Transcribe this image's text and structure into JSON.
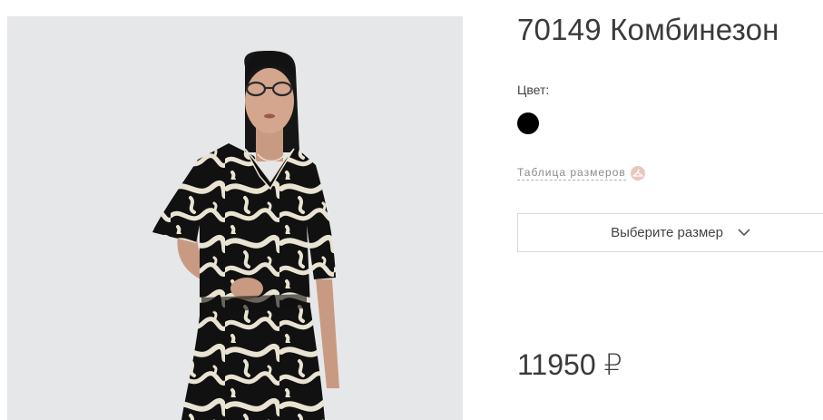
{
  "product": {
    "title": "70149 Комбинезон",
    "price": "11950 ₽"
  },
  "color": {
    "label": "Цвет:",
    "selected_swatch": "#000000"
  },
  "size_table": {
    "label": "Таблица размеров",
    "icon": "hanger-icon"
  },
  "size_select": {
    "label": "Выберите размер",
    "icon": "chevron-down-icon"
  },
  "photo": {
    "background": "#e6e7e9"
  }
}
